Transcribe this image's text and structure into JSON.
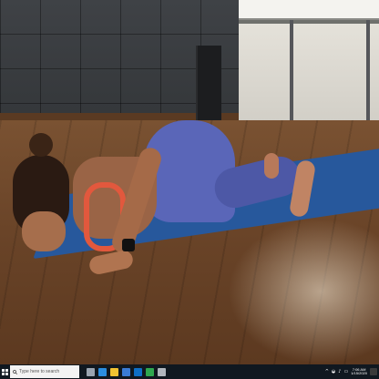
{
  "taskbar": {
    "search_placeholder": "Type here to search",
    "time": "7:06 AM",
    "date": "1/15/2020",
    "pinned_icons": [
      {
        "name": "task-view-icon",
        "color": "#9aa4b0"
      },
      {
        "name": "edge-icon",
        "color": "#2b8de0"
      },
      {
        "name": "file-explorer-icon",
        "color": "#f1c232"
      },
      {
        "name": "store-icon",
        "color": "#3a7bd5"
      },
      {
        "name": "mail-icon",
        "color": "#0f6fc6"
      },
      {
        "name": "chrome-icon",
        "color": "#2fa84f"
      },
      {
        "name": "app-icon",
        "color": "#b0b6bd"
      }
    ],
    "tray_symbols": {
      "chevron": "^",
      "network": "◒",
      "volume": "♪",
      "keyboard": "▭"
    }
  },
  "colors": {
    "taskbar_bg": "#101820",
    "mat": "#27589c",
    "leggings": "#5a66b8",
    "sports_bra": "#e2583d"
  }
}
